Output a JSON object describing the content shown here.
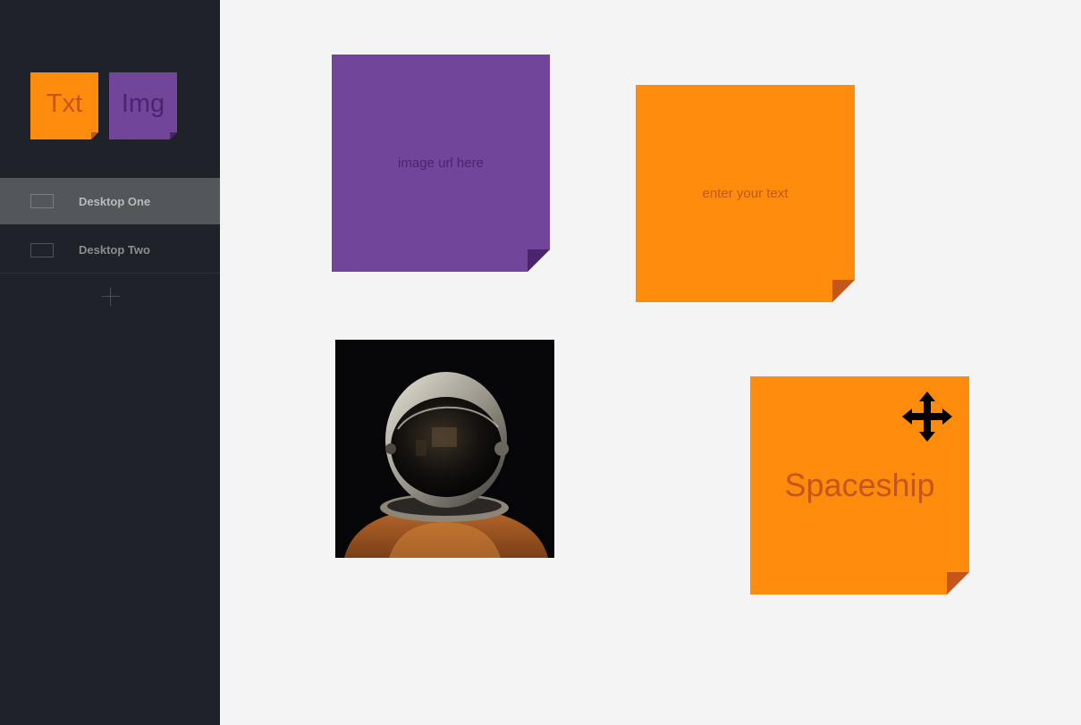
{
  "sidebar": {
    "tools": {
      "txt_label": "Txt",
      "img_label": "Img"
    },
    "desktops": [
      {
        "label": "Desktop One",
        "active": true
      },
      {
        "label": "Desktop Two",
        "active": false
      }
    ],
    "add_icon": "plus-icon"
  },
  "canvas": {
    "notes": {
      "image_note": {
        "placeholder": "image url here",
        "color": "#71469a"
      },
      "text_note": {
        "placeholder": "enter your text",
        "color": "#fd8c0c"
      },
      "spaceship_note": {
        "text": "Spaceship",
        "color": "#fd8c0c"
      }
    },
    "photo": {
      "subject": "astronaut-helmet-photo"
    },
    "move_icon": "move-arrows-icon"
  },
  "colors": {
    "orange": "#fd8c0c",
    "orange_dark": "#c4561a",
    "purple": "#71469a",
    "purple_dark": "#4a256e",
    "sidebar_bg": "#1f2228",
    "canvas_bg": "#f4f4f4"
  }
}
